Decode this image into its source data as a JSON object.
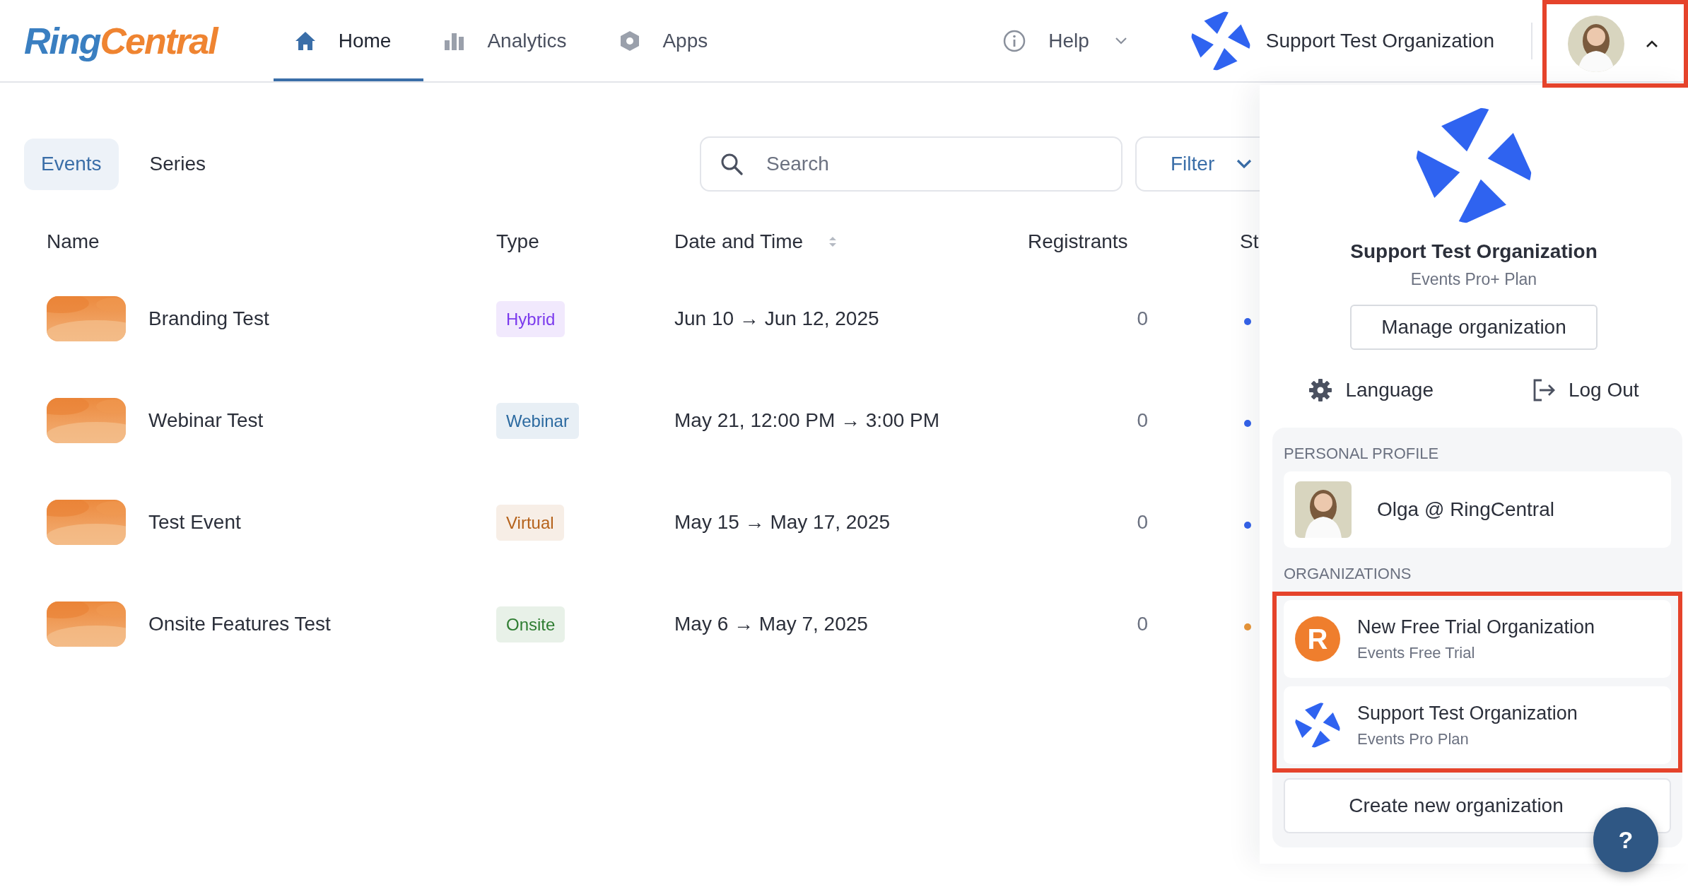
{
  "logo": {
    "part1": "Ring",
    "part2": "Central"
  },
  "nav": [
    {
      "label": "Home",
      "selected": true
    },
    {
      "label": "Analytics",
      "selected": false
    },
    {
      "label": "Apps",
      "selected": false
    }
  ],
  "help_menu": {
    "label": "Help"
  },
  "current_org": {
    "name": "Support Test Organization"
  },
  "user_menu": {
    "expanded": true,
    "highlighted": true
  },
  "view_tabs": [
    {
      "label": "Events",
      "selected": true
    },
    {
      "label": "Series",
      "selected": false
    }
  ],
  "search": {
    "placeholder": "Search"
  },
  "filter": {
    "label": "Filter"
  },
  "table": {
    "columns": [
      "Name",
      "Type",
      "Date and Time",
      "Registrants",
      "St"
    ],
    "rows": [
      {
        "name": "Branding Test",
        "type": {
          "label": "Hybrid",
          "color": "#7b3aed"
        },
        "date": "Jun 10 → Jun 12, 2025",
        "registrants": "0",
        "status": {
          "color": "#3563e9"
        }
      },
      {
        "name": "Webinar Test",
        "type": {
          "label": "Webinar",
          "color": "#2c6aa0"
        },
        "date": "May 21, 12:00 PM → 3:00 PM",
        "registrants": "0",
        "status": {
          "color": "#3563e9"
        }
      },
      {
        "name": "Test Event",
        "type": {
          "label": "Virtual",
          "color": "#b5621b"
        },
        "date": "May 15 → May 17, 2025",
        "registrants": "0",
        "status": {
          "color": "#3563e9"
        }
      },
      {
        "name": "Onsite Features Test",
        "type": {
          "label": "Onsite",
          "color": "#2f7d32"
        },
        "date": "May 6 → May 7, 2025",
        "registrants": "0",
        "status": {
          "color": "#e8963a"
        }
      }
    ]
  },
  "dropdown": {
    "org_name": "Support Test Organization",
    "plan": "Events Pro+ Plan",
    "manage_button": "Manage organization",
    "language": "Language",
    "logout": "Log Out",
    "profile_heading": "PERSONAL PROFILE",
    "profile": {
      "name": "Olga @ RingCentral"
    },
    "orgs_heading": "ORGANIZATIONS",
    "orgs_highlighted": true,
    "orgs": [
      {
        "kind": "letter",
        "logo_text": "R",
        "name": "New Free Trial Organization",
        "plan": "Events Free Trial"
      },
      {
        "kind": "pinwheel",
        "name": "Support Test Organization",
        "plan": "Events Pro Plan"
      }
    ],
    "create_button": "Create new organization"
  },
  "help_fab": {
    "label": "?"
  }
}
